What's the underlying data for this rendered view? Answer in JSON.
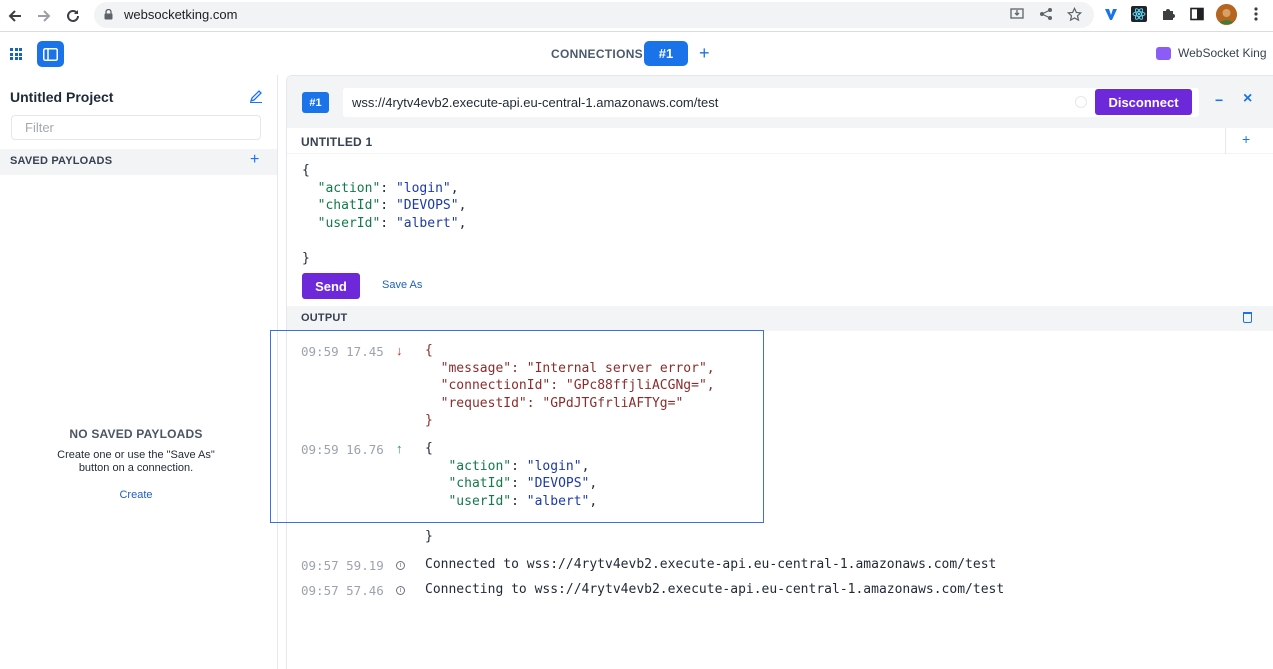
{
  "browser": {
    "url": "websocketking.com",
    "icons": [
      "back-icon",
      "forward-icon",
      "reload-icon",
      "lock-icon",
      "install-icon",
      "share-icon",
      "star-icon",
      "extension-v-icon",
      "react-icon",
      "puzzle-icon",
      "sidepanel-icon",
      "profile-avatar",
      "menu-icon"
    ]
  },
  "header": {
    "connections_label": "CONNECTIONS",
    "active_tab": "#1",
    "add_tab": "+",
    "brand": "WebSocket King"
  },
  "sidebar": {
    "project_title": "Untitled Project",
    "filter_placeholder": "Filter",
    "saved_payloads_label": "SAVED PAYLOADS",
    "add": "+",
    "empty_title": "NO SAVED PAYLOADS",
    "empty_line1": "Create one or use the \"Save As\"",
    "empty_line2": "button on a connection.",
    "create_link": "Create"
  },
  "connection": {
    "badge": "#1",
    "url": "wss://4rytv4evb2.execute-api.eu-central-1.amazonaws.com/test",
    "disconnect_label": "Disconnect",
    "minimize": "−",
    "close": "×"
  },
  "editor": {
    "title": "UNTITLED 1",
    "add": "+",
    "open_brace": "{",
    "lines": [
      {
        "key": "\"action\"",
        "value": "\"login\""
      },
      {
        "key": "\"chatId\"",
        "value": "\"DEVOPS\""
      },
      {
        "key": "\"userId\"",
        "value": "\"albert\""
      }
    ],
    "close_brace": "}",
    "send_label": "Send",
    "saveas_label": "Save As"
  },
  "output": {
    "title": "OUTPUT",
    "entries": [
      {
        "time": "09:59 17.45",
        "direction": "received"
      },
      {
        "time": "09:59 16.76",
        "direction": "sent"
      },
      {
        "time": "09:57 59.19",
        "direction": "info",
        "text": "Connected to wss://4rytv4evb2.execute-api.eu-central-1.amazonaws.com/test"
      },
      {
        "time": "09:57 57.46",
        "direction": "info",
        "text": "Connecting to wss://4rytv4evb2.execute-api.eu-central-1.amazonaws.com/test"
      }
    ],
    "received": [
      {
        "key": "\"message\"",
        "value": "\"Internal server error\""
      },
      {
        "key": "\"connectionId\"",
        "value": "\"GPc88ffjliACGNg=\""
      },
      {
        "key": "\"requestId\"",
        "value": "\"GPdJTGfrliAFTYg=\""
      }
    ],
    "sent": [
      {
        "key": "\"action\"",
        "value": "\"login\""
      },
      {
        "key": "\"chatId\"",
        "value": "\"DEVOPS\""
      },
      {
        "key": "\"userId\"",
        "value": "\"albert\""
      }
    ]
  },
  "colors": {
    "accent_blue": "#1a73e8",
    "accent_purple": "#6d28d9",
    "highlight_border": "#3b6fe8"
  }
}
